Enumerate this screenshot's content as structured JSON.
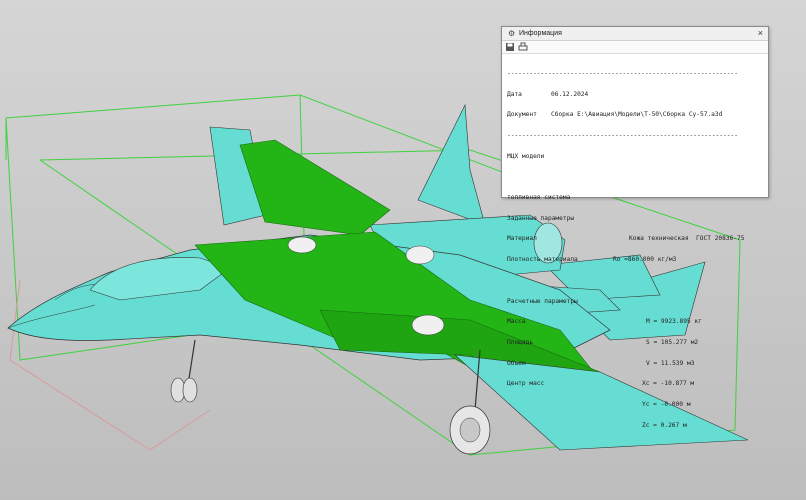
{
  "colors": {
    "aircraft": "#66ddd3",
    "wing_highlight": "#22b515",
    "bounding_box": "#3fd13f",
    "background": "#c8c8c8"
  },
  "info_window": {
    "title": "Информация",
    "icons": [
      "gear-icon",
      "save-icon",
      "print-icon",
      "close-icon"
    ],
    "close_glyph": "×",
    "separator": "--------------------------------------------------------------",
    "date_label": "Дата",
    "date_value": "06.12.2024",
    "doc_label": "Документ",
    "doc_value": "Сборка E:\\Авиация\\Модели\\T-50\\Сборка Су-57.a3d",
    "mcx_title": "МЦХ модели",
    "fuel_system": "топливная система",
    "given_params": "Заданные параметры",
    "material_label": "Материал",
    "material_value": "Кожа техническая  ГОСТ 20836-75",
    "density_label": "Плотность материала",
    "density_value": "Ro =860.000 кг/м3",
    "calc_params": "Расчетные параметры",
    "mass_label": "Масса",
    "mass_value": "M = 9923.895 кг",
    "area_label": "Площадь",
    "area_value": "S = 105.277 м2",
    "volume_label": "Объем",
    "volume_value": "V = 11.539 м3",
    "center_label": "Центр масс",
    "xc_value": "Xc = -10.877 м",
    "yc_value": "Yc = -0.000 м",
    "zc_value": "Zc = 0.267 м"
  }
}
